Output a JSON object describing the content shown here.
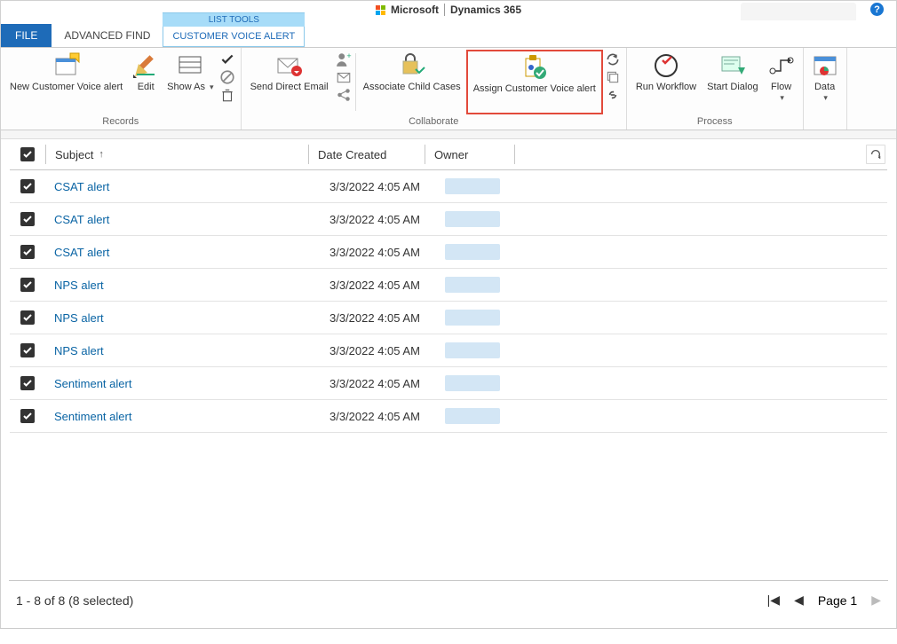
{
  "brand": {
    "company": "Microsoft",
    "product": "Dynamics 365"
  },
  "tabs": {
    "file": "FILE",
    "advanced_find": "ADVANCED FIND",
    "list_tools": "LIST TOOLS",
    "customer_voice_alert": "CUSTOMER VOICE ALERT"
  },
  "ribbon": {
    "records": {
      "title": "Records",
      "new_alert": "New Customer Voice alert",
      "edit": "Edit",
      "show_as": "Show As"
    },
    "collaborate": {
      "title": "Collaborate",
      "send_email": "Send Direct Email",
      "associate_child": "Associate Child Cases",
      "assign_alert": "Assign Customer Voice alert"
    },
    "process": {
      "title": "Process",
      "run_workflow": "Run Workflow",
      "start_dialog": "Start Dialog",
      "flow": "Flow"
    },
    "data": {
      "title": "",
      "data": "Data"
    }
  },
  "grid": {
    "columns": {
      "subject": "Subject",
      "date_created": "Date Created",
      "owner": "Owner"
    },
    "sort_asc_on": "subject",
    "rows": [
      {
        "subject": "CSAT alert",
        "date_created": "3/3/2022 4:05 AM",
        "checked": true
      },
      {
        "subject": "CSAT alert",
        "date_created": "3/3/2022 4:05 AM",
        "checked": true
      },
      {
        "subject": "CSAT alert",
        "date_created": "3/3/2022 4:05 AM",
        "checked": true
      },
      {
        "subject": "NPS alert",
        "date_created": "3/3/2022 4:05 AM",
        "checked": true
      },
      {
        "subject": "NPS alert",
        "date_created": "3/3/2022 4:05 AM",
        "checked": true
      },
      {
        "subject": "NPS alert",
        "date_created": "3/3/2022 4:05 AM",
        "checked": true
      },
      {
        "subject": "Sentiment alert",
        "date_created": "3/3/2022 4:05 AM",
        "checked": true
      },
      {
        "subject": "Sentiment alert",
        "date_created": "3/3/2022 4:05 AM",
        "checked": true
      }
    ]
  },
  "footer": {
    "range_text": "1 - 8 of 8 (8 selected)",
    "page_label": "Page 1"
  }
}
